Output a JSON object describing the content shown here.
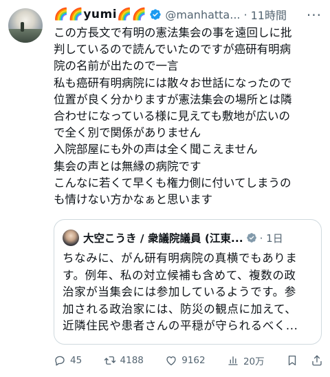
{
  "author": {
    "display_name": "🌈🌈yumi🌈🌈",
    "handle": "@manhatta...",
    "time_separator": "·",
    "time": "11時間"
  },
  "menu_label": "···",
  "tweet_lines": [
    "この方長文で有明の憲法集会の事を遠回しに批",
    "判しているので読んでいたのですが癌研有明病",
    "院の名前が出たので一言",
    "私も癌研有明病院には散々お世話になったので",
    "位置が良く分かりますが憲法集会の場所とは隣",
    "合わせになっている様に見えても敷地が広いの",
    "で全く別で関係がありません",
    "入院部屋にも外の声は全く聞こえません",
    "集会の声とは無縁の病院です",
    "こんなに若くて早くも権力側に付いてしまうの",
    "も情けない方かなぁと思います"
  ],
  "quote": {
    "author_name": "大空こうき / 衆議院議員 (江東...",
    "meta": "· 1日",
    "lines": [
      "ちなみに、がん研有明病院の真横でもありま",
      "す。例年、私の対立候補も含めて、複数の政",
      "治家が当集会には参加しているようです。参",
      "加される政治家には、防災の観点に加えて、",
      "近隣住民や患者さんの平穏が守られるべく..."
    ]
  },
  "actions": {
    "replies": "45",
    "reposts": "4188",
    "likes": "9162",
    "views": "20万"
  },
  "colors": {
    "text": "#0f1419",
    "secondary": "#536471",
    "verified": "#1d9bf0",
    "quote_verified": "#829aab",
    "border": "#cfd9de"
  },
  "icons": [
    "avatar",
    "verified-badge-icon",
    "more-icon",
    "reply-icon",
    "repost-icon",
    "like-icon",
    "views-icon",
    "bookmark-icon",
    "share-icon"
  ]
}
